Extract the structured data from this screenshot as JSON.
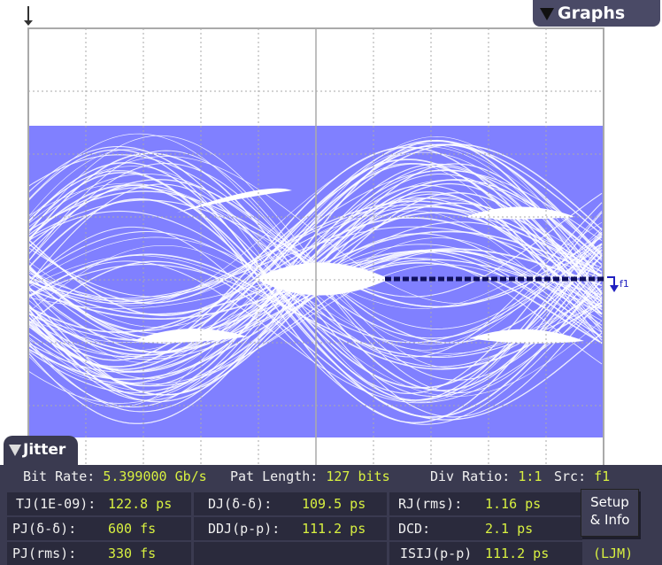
{
  "graphs_tab": {
    "label": "Graphs"
  },
  "marker": {
    "label": "f1"
  },
  "jitter_tab": {
    "label": "Jitter"
  },
  "summary": {
    "bit_rate_label": "Bit Rate:",
    "bit_rate": "5.399000 Gb/s",
    "pat_length_label": "Pat Length:",
    "pat_length": "127 bits",
    "div_ratio_label": "Div Ratio:",
    "div_ratio": "1:1",
    "src_label": "Src:",
    "src": "f1"
  },
  "measurements": [
    {
      "label": "TJ(1E-09):",
      "value": "122.8 ps"
    },
    {
      "label": "DJ(δ-δ):",
      "value": "109.5 ps"
    },
    {
      "label": "RJ(rms):",
      "value": "1.16 ps"
    },
    {
      "label": "PJ(δ-δ):",
      "value": "600 fs"
    },
    {
      "label": "DDJ(p-p):",
      "value": "111.2 ps"
    },
    {
      "label": "DCD:",
      "value": "2.1 ps"
    },
    {
      "label": "PJ(rms):",
      "value": "330 fs"
    },
    {
      "label": "",
      "value": ""
    },
    {
      "label": "ISIJ(p-p)",
      "value": "111.2 ps"
    }
  ],
  "setup_button": {
    "line1": "Setup",
    "line2": "& Info"
  },
  "mode": "(LJM)",
  "colors": {
    "trace": "#8080ff",
    "panel": "#3a3a50",
    "value": "#d8f040"
  }
}
